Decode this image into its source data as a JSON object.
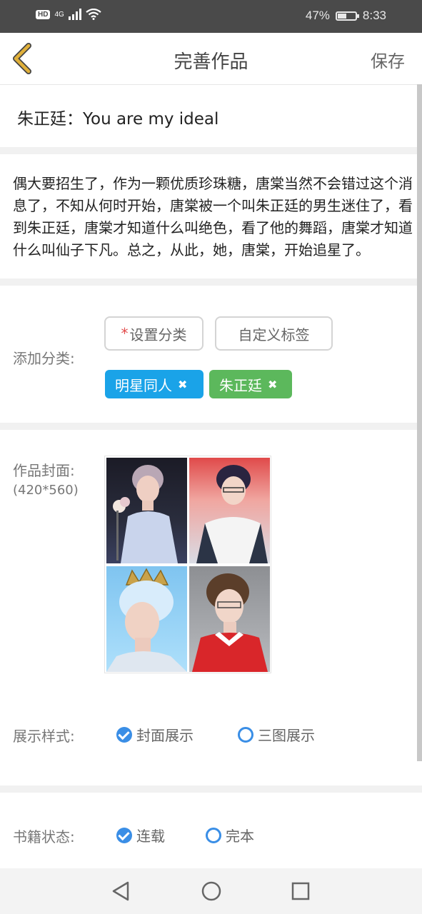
{
  "status_bar": {
    "network_badge": "HD",
    "network_type": "4G",
    "battery_percent_text": "47%",
    "battery_level": 0.47,
    "time": "8:33"
  },
  "nav": {
    "title": "完善作品",
    "save_label": "保存"
  },
  "work": {
    "title": "朱正廷：You are my ideal",
    "description": "偶大要招生了，作为一颗优质珍珠糖，唐棠当然不会错过这个消息了，不知从何时开始，唐棠被一个叫朱正廷的男生迷住了，看到朱正廷，唐棠才知道什么叫绝色，看了他的舞蹈，唐棠才知道什么叫仙子下凡。总之，从此，她，唐棠，开始追星了。"
  },
  "category": {
    "label": "添加分类:",
    "set_category_star": "*",
    "set_category_label": "设置分类",
    "custom_tag_label": "自定义标签",
    "tags": [
      {
        "label": "明星同人",
        "color": "#1aa3e8"
      },
      {
        "label": "朱正廷",
        "color": "#5cb85c"
      }
    ]
  },
  "cover": {
    "label": "作品封面:",
    "size_hint": "(420*560)"
  },
  "display_style": {
    "label": "展示样式:",
    "options": [
      {
        "label": "封面展示",
        "checked": true
      },
      {
        "label": "三图展示",
        "checked": false
      }
    ]
  },
  "book_status": {
    "label": "书籍状态:",
    "options": [
      {
        "label": "连载",
        "checked": true
      },
      {
        "label": "完本",
        "checked": false
      }
    ]
  },
  "colors": {
    "accent": "#3a8ee6",
    "back_arrow": "#e0b03a",
    "required_star": "#e24b4b"
  },
  "icons": {
    "back": "chevron-left-icon",
    "tag_remove": "close-icon",
    "android_back": "triangle-back-icon",
    "android_home": "circle-home-icon",
    "android_recent": "square-recent-icon"
  }
}
